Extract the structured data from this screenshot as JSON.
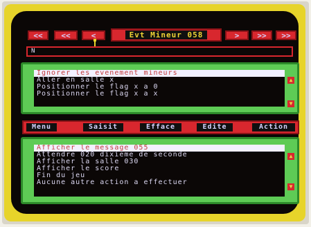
{
  "colors": {
    "frame": "#e7d42a",
    "screen": "#0b0706",
    "red": "#d8272e",
    "green": "#5ecb55",
    "selected_bg": "#f2f0ff"
  },
  "nav": {
    "first": "<<",
    "prev": "<<",
    "back": "<",
    "title": "Evt Mineur 058",
    "next": ">",
    "next2": ">>",
    "last": ">>"
  },
  "input": {
    "value": "N"
  },
  "conditions": [
    "Ignorer les evenement mineurs",
    "Aller en salle x",
    "Positionner le flag x a 0",
    "Positionner le flag x a x"
  ],
  "menu": [
    "Menu",
    "Saisit",
    "Efface",
    "Edite",
    "Action"
  ],
  "actions": [
    "Afficher le message 055",
    "Attendre 020 dixieme de seconde",
    "Afficher la salle 030",
    "Afficher le score",
    "Fin du jeu",
    "Aucune autre action a effectuer"
  ],
  "scroll": {
    "up": "▲",
    "down": "▼"
  }
}
